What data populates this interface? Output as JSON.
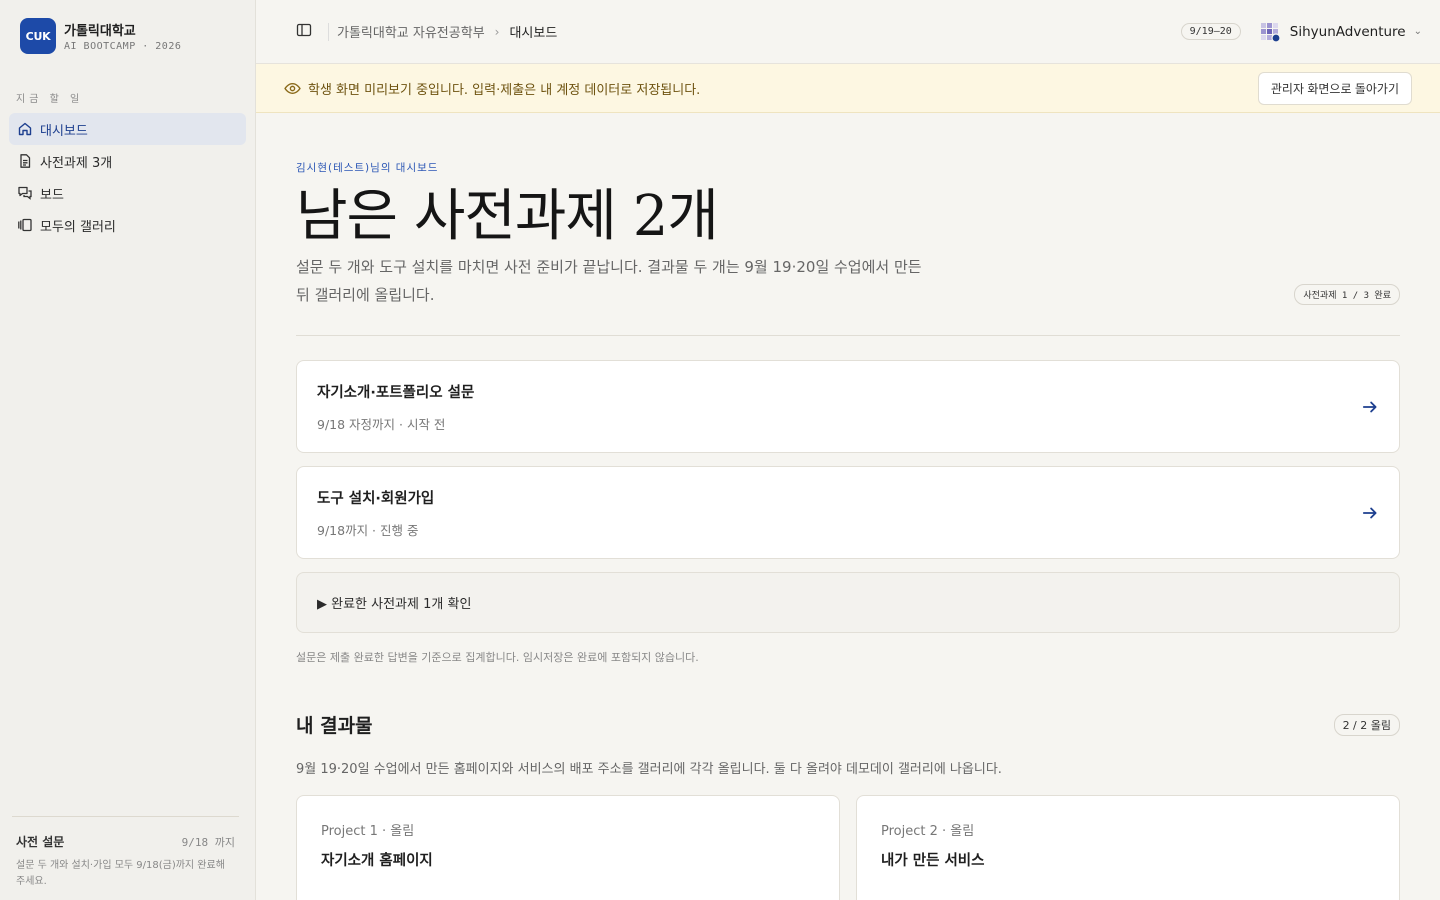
{
  "brand": {
    "logo_text": "CUK",
    "name": "가톨릭대학교",
    "sub": "AI BOOTCAMP · 2026",
    "accent_color": "#1d4aa8"
  },
  "sidebar": {
    "section_label": "지금 할 일",
    "items": [
      {
        "label": "대시보드",
        "icon": "home-icon",
        "active": true
      },
      {
        "label": "사전과제 3개",
        "icon": "document-icon",
        "active": false
      },
      {
        "label": "보드",
        "icon": "chat-icon",
        "active": false
      },
      {
        "label": "모두의 갤러리",
        "icon": "gallery-icon",
        "active": false
      }
    ],
    "footer": {
      "title": "사전 설문",
      "date": "9/18 까지",
      "desc": "설문 두 개와 설치·가입 모두 9/18(금)까지 완료해 주세요."
    }
  },
  "topbar": {
    "breadcrumb": [
      "가톨릭대학교 자유전공학부",
      "대시보드"
    ],
    "date_pill": "9/19–20",
    "user_name": "SihyunAdventure"
  },
  "banner": {
    "text": "학생 화면 미리보기 중입니다. 입력·제출은 내 계정 데이터로 저장됩니다.",
    "button": "관리자 화면으로 돌아가기"
  },
  "main": {
    "kicker": "김시현(테스트)님의 대시보드",
    "headline": "남은 사전과제 2개",
    "intro": "설문 두 개와 도구 설치를 마치면 사전 준비가 끝납니다. 결과물 두 개는 9월 19·20일 수업에서 만든 뒤 갤러리에 올립니다.",
    "progress": "사전과제 1 / 3 완료",
    "tasks": [
      {
        "title": "자기소개·포트폴리오 설문",
        "meta": "9/18 자정까지 · 시작 전"
      },
      {
        "title": "도구 설치·회원가입",
        "meta": "9/18까지 · 진행 중"
      }
    ],
    "done_toggle": "▶ 완료한 사전과제 1개 확인",
    "note": "설문은 제출 완료한 답변을 기준으로 집계합니다. 임시저장은 완료에 포함되지 않습니다."
  },
  "results": {
    "title": "내 결과물",
    "pill": "2 / 2 올림",
    "desc": "9월 19·20일 수업에서 만든 홈페이지와 서비스의 배포 주소를 갤러리에 각각 올립니다. 둘 다 올려야 데모데이 갤러리에 나옵니다.",
    "projects": [
      {
        "meta": "Project 1 · 올림",
        "title": "자기소개 홈페이지"
      },
      {
        "meta": "Project 2 · 올림",
        "title": "내가 만든 서비스"
      }
    ]
  }
}
